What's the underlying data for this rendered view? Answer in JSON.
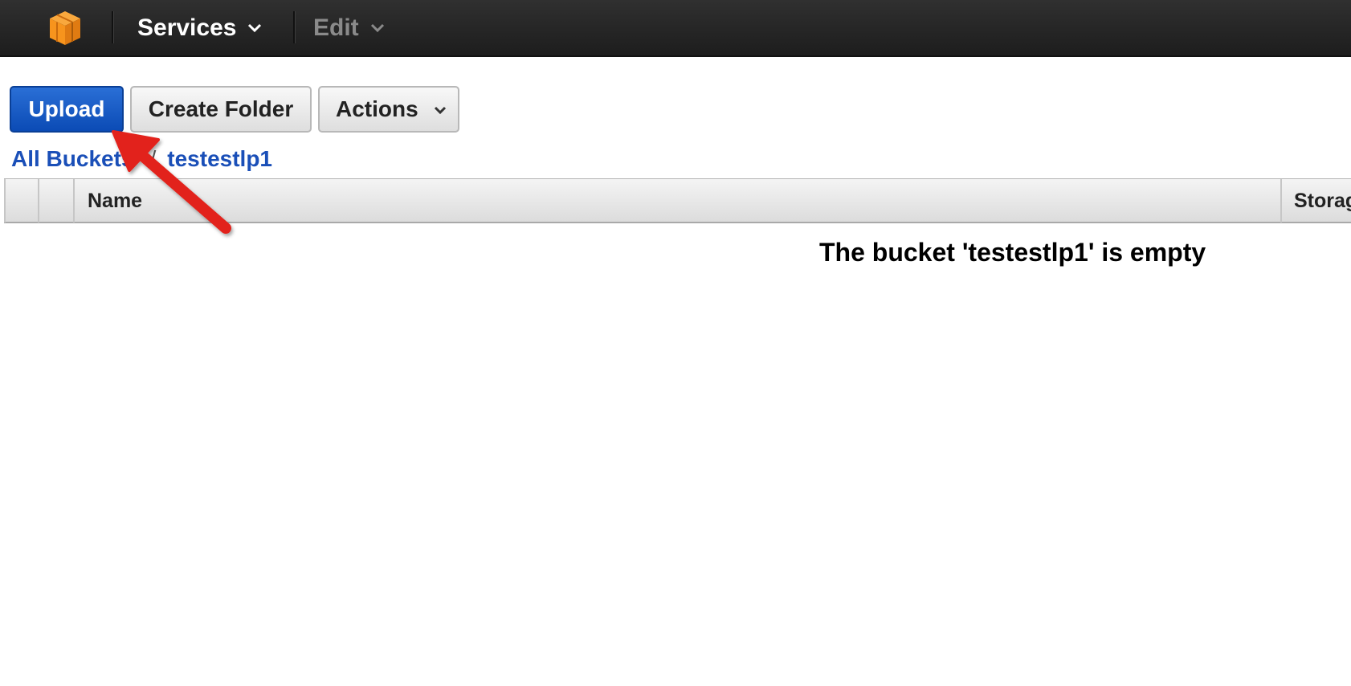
{
  "topbar": {
    "logo_icon": "aws-cube-icon",
    "services_label": "Services",
    "edit_label": "Edit"
  },
  "toolbar": {
    "upload_label": "Upload",
    "create_folder_label": "Create Folder",
    "actions_label": "Actions"
  },
  "breadcrumb": {
    "root_label": "All Buckets",
    "separator": "/",
    "bucket_label": "testestlp1"
  },
  "table": {
    "columns": [
      "",
      "",
      "Name",
      "Storag"
    ]
  },
  "empty_message": "The bucket 'testestlp1' is empty",
  "colors": {
    "topbar_bg": "#232323",
    "primary_button": "#0b4bb5",
    "link": "#1a4fb8",
    "logo_orange": "#f7941d",
    "annotation_arrow": "#e2231a"
  }
}
